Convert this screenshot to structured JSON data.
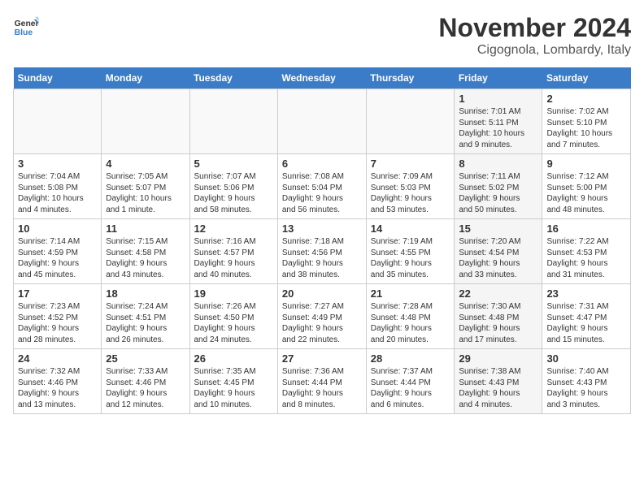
{
  "header": {
    "logo_line1": "General",
    "logo_line2": "Blue",
    "month_title": "November 2024",
    "location": "Cigognola, Lombardy, Italy"
  },
  "weekdays": [
    "Sunday",
    "Monday",
    "Tuesday",
    "Wednesday",
    "Thursday",
    "Friday",
    "Saturday"
  ],
  "weeks": [
    [
      {
        "day": "",
        "info": "",
        "empty": true
      },
      {
        "day": "",
        "info": "",
        "empty": true
      },
      {
        "day": "",
        "info": "",
        "empty": true
      },
      {
        "day": "",
        "info": "",
        "empty": true
      },
      {
        "day": "",
        "info": "",
        "empty": true
      },
      {
        "day": "1",
        "info": "Sunrise: 7:01 AM\nSunset: 5:11 PM\nDaylight: 10 hours\nand 9 minutes.",
        "shaded": true
      },
      {
        "day": "2",
        "info": "Sunrise: 7:02 AM\nSunset: 5:10 PM\nDaylight: 10 hours\nand 7 minutes.",
        "shaded": false
      }
    ],
    [
      {
        "day": "3",
        "info": "Sunrise: 7:04 AM\nSunset: 5:08 PM\nDaylight: 10 hours\nand 4 minutes.",
        "shaded": false
      },
      {
        "day": "4",
        "info": "Sunrise: 7:05 AM\nSunset: 5:07 PM\nDaylight: 10 hours\nand 1 minute.",
        "shaded": false
      },
      {
        "day": "5",
        "info": "Sunrise: 7:07 AM\nSunset: 5:06 PM\nDaylight: 9 hours\nand 58 minutes.",
        "shaded": false
      },
      {
        "day": "6",
        "info": "Sunrise: 7:08 AM\nSunset: 5:04 PM\nDaylight: 9 hours\nand 56 minutes.",
        "shaded": false
      },
      {
        "day": "7",
        "info": "Sunrise: 7:09 AM\nSunset: 5:03 PM\nDaylight: 9 hours\nand 53 minutes.",
        "shaded": false
      },
      {
        "day": "8",
        "info": "Sunrise: 7:11 AM\nSunset: 5:02 PM\nDaylight: 9 hours\nand 50 minutes.",
        "shaded": true
      },
      {
        "day": "9",
        "info": "Sunrise: 7:12 AM\nSunset: 5:00 PM\nDaylight: 9 hours\nand 48 minutes.",
        "shaded": false
      }
    ],
    [
      {
        "day": "10",
        "info": "Sunrise: 7:14 AM\nSunset: 4:59 PM\nDaylight: 9 hours\nand 45 minutes.",
        "shaded": false
      },
      {
        "day": "11",
        "info": "Sunrise: 7:15 AM\nSunset: 4:58 PM\nDaylight: 9 hours\nand 43 minutes.",
        "shaded": false
      },
      {
        "day": "12",
        "info": "Sunrise: 7:16 AM\nSunset: 4:57 PM\nDaylight: 9 hours\nand 40 minutes.",
        "shaded": false
      },
      {
        "day": "13",
        "info": "Sunrise: 7:18 AM\nSunset: 4:56 PM\nDaylight: 9 hours\nand 38 minutes.",
        "shaded": false
      },
      {
        "day": "14",
        "info": "Sunrise: 7:19 AM\nSunset: 4:55 PM\nDaylight: 9 hours\nand 35 minutes.",
        "shaded": false
      },
      {
        "day": "15",
        "info": "Sunrise: 7:20 AM\nSunset: 4:54 PM\nDaylight: 9 hours\nand 33 minutes.",
        "shaded": true
      },
      {
        "day": "16",
        "info": "Sunrise: 7:22 AM\nSunset: 4:53 PM\nDaylight: 9 hours\nand 31 minutes.",
        "shaded": false
      }
    ],
    [
      {
        "day": "17",
        "info": "Sunrise: 7:23 AM\nSunset: 4:52 PM\nDaylight: 9 hours\nand 28 minutes.",
        "shaded": false
      },
      {
        "day": "18",
        "info": "Sunrise: 7:24 AM\nSunset: 4:51 PM\nDaylight: 9 hours\nand 26 minutes.",
        "shaded": false
      },
      {
        "day": "19",
        "info": "Sunrise: 7:26 AM\nSunset: 4:50 PM\nDaylight: 9 hours\nand 24 minutes.",
        "shaded": false
      },
      {
        "day": "20",
        "info": "Sunrise: 7:27 AM\nSunset: 4:49 PM\nDaylight: 9 hours\nand 22 minutes.",
        "shaded": false
      },
      {
        "day": "21",
        "info": "Sunrise: 7:28 AM\nSunset: 4:48 PM\nDaylight: 9 hours\nand 20 minutes.",
        "shaded": false
      },
      {
        "day": "22",
        "info": "Sunrise: 7:30 AM\nSunset: 4:48 PM\nDaylight: 9 hours\nand 17 minutes.",
        "shaded": true
      },
      {
        "day": "23",
        "info": "Sunrise: 7:31 AM\nSunset: 4:47 PM\nDaylight: 9 hours\nand 15 minutes.",
        "shaded": false
      }
    ],
    [
      {
        "day": "24",
        "info": "Sunrise: 7:32 AM\nSunset: 4:46 PM\nDaylight: 9 hours\nand 13 minutes.",
        "shaded": false
      },
      {
        "day": "25",
        "info": "Sunrise: 7:33 AM\nSunset: 4:46 PM\nDaylight: 9 hours\nand 12 minutes.",
        "shaded": false
      },
      {
        "day": "26",
        "info": "Sunrise: 7:35 AM\nSunset: 4:45 PM\nDaylight: 9 hours\nand 10 minutes.",
        "shaded": false
      },
      {
        "day": "27",
        "info": "Sunrise: 7:36 AM\nSunset: 4:44 PM\nDaylight: 9 hours\nand 8 minutes.",
        "shaded": false
      },
      {
        "day": "28",
        "info": "Sunrise: 7:37 AM\nSunset: 4:44 PM\nDaylight: 9 hours\nand 6 minutes.",
        "shaded": false
      },
      {
        "day": "29",
        "info": "Sunrise: 7:38 AM\nSunset: 4:43 PM\nDaylight: 9 hours\nand 4 minutes.",
        "shaded": true
      },
      {
        "day": "30",
        "info": "Sunrise: 7:40 AM\nSunset: 4:43 PM\nDaylight: 9 hours\nand 3 minutes.",
        "shaded": false
      }
    ]
  ]
}
